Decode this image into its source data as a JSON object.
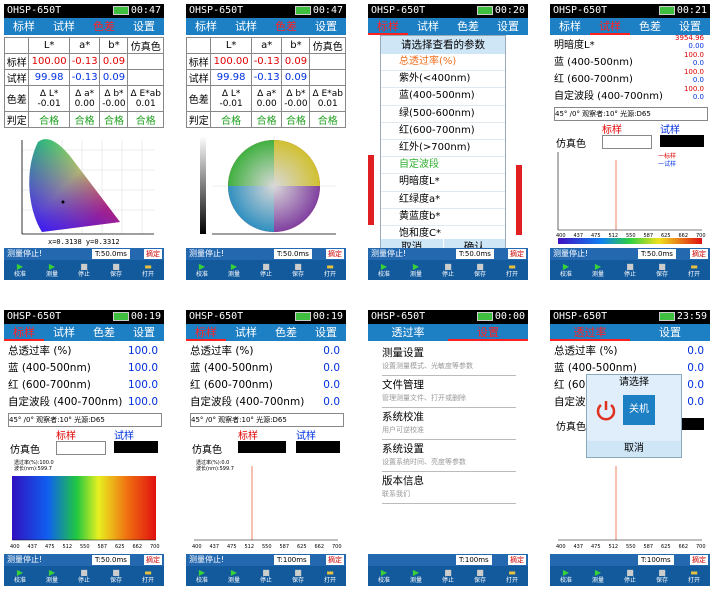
{
  "device": {
    "model": "OHSP-650T"
  },
  "status_common": {
    "measure_stopped": "测量停止!",
    "mode": "摘定"
  },
  "nav": [
    "校准",
    "测量",
    "停止",
    "保存",
    "打开"
  ],
  "tabs_main": [
    "标样",
    "试样",
    "色差",
    "设置"
  ],
  "tabs_settings": [
    "透过率",
    "设置"
  ],
  "times": [
    "00:47",
    "00:47",
    "00:20",
    "00:21",
    "00:19",
    "00:19",
    "00:00",
    "23:59"
  ],
  "exposure": [
    "T:50.0ms",
    "T:50.0ms",
    "T:50.0ms",
    "T:50.0ms",
    "T:50.0ms",
    "T:100ms",
    "T:100ms",
    "T:100ms"
  ],
  "colordiff": {
    "headers": [
      "",
      "L*",
      "a*",
      "b*",
      "仿真色"
    ],
    "rows": [
      {
        "label": "标样",
        "L": "100.00",
        "a": "-0.13",
        "b": "0.09"
      },
      {
        "label": "试样",
        "L": "99.98",
        "a": "-0.13",
        "b": "0.09"
      }
    ],
    "delta_label": "色差",
    "delta_names": [
      "Δ L*",
      "Δ a*",
      "Δ b*",
      "Δ E*ab"
    ],
    "delta_values": [
      "-0.01",
      "0.00",
      "-0.00",
      "0.01"
    ],
    "judge_label": "判定",
    "judge_values": [
      "合格",
      "合格",
      "合格",
      "合格"
    ],
    "chromaticity": "x=0.3138  y=0.3312"
  },
  "param_menu": {
    "title": "请选择查看的参数",
    "items": [
      "总透过率(%)",
      "紫外(<400nm)",
      "蓝(400-500nm)",
      "绿(500-600nm)",
      "红(600-700nm)",
      "红外(>700nm)",
      "自定波段",
      "明暗度L*",
      "红绿度a*",
      "黄蓝度b*",
      "饱和度C*"
    ],
    "cancel": "取消",
    "confirm": "确认"
  },
  "lightness_screen": {
    "rows": [
      {
        "label": "明暗度L*",
        "v1": "3954.96",
        "v2": "0.00"
      },
      {
        "label": "蓝 (400-500nm)",
        "v1": "100.0",
        "v2": "0.0"
      },
      {
        "label": "红 (600-700nm)",
        "v1": "100.0",
        "v2": "0.0"
      },
      {
        "label": "自定波段 (400-700nm)",
        "v1": "100.0",
        "v2": "0.0"
      }
    ],
    "info": "45° /0°  观察者:10°  光源:D65",
    "std": "标样",
    "smp": "试样",
    "sim": "仿真色",
    "legend1": "一标样",
    "legend2": "一试样"
  },
  "trans_screen": {
    "rows": [
      {
        "label": "总透过率 (%)",
        "v": "100.0"
      },
      {
        "label": "蓝 (400-500nm)",
        "v": "100.0"
      },
      {
        "label": "红 (600-700nm)",
        "v": "100.0"
      },
      {
        "label": "自定波段 (400-700nm)",
        "v": "100.0"
      }
    ],
    "rows2": [
      {
        "label": "总透过率 (%)",
        "v": "0.0"
      },
      {
        "label": "蓝 (400-500nm)",
        "v": "0.0"
      },
      {
        "label": "红 (600-700nm)",
        "v": "0.0"
      },
      {
        "label": "自定波段 (400-700nm)",
        "v": "0.0"
      }
    ],
    "info": "45° /0°  观察者:10°  光源:D65",
    "std": "标样",
    "smp": "试样",
    "sim": "仿真色",
    "spec_note1": "透过率(%):0.0",
    "spec_note2": "波长(nm):599.7",
    "spec_note1b": "透过率(%):100.0"
  },
  "wl_ticks": [
    "400",
    "437",
    "475",
    "512",
    "550",
    "587",
    "625",
    "662",
    "700"
  ],
  "settings_menu": [
    {
      "title": "测量设置",
      "sub": "设置测量模式、光敏度等参数"
    },
    {
      "title": "文件管理",
      "sub": "管理测量文件、打开或删除"
    },
    {
      "title": "系统校准",
      "sub": "用户可逆校准"
    },
    {
      "title": "系统设置",
      "sub": "设置系统时间、亮度等参数"
    },
    {
      "title": "版本信息",
      "sub": "联系我们"
    }
  ],
  "power_dialog": {
    "title": "请选择",
    "shutdown": "关机",
    "cancel": "取消"
  },
  "colors": {
    "tab_bg": "#1d7fc4",
    "accent_red": "#e00000",
    "value_blue": "#0030e0",
    "pass_green": "#20a020"
  }
}
